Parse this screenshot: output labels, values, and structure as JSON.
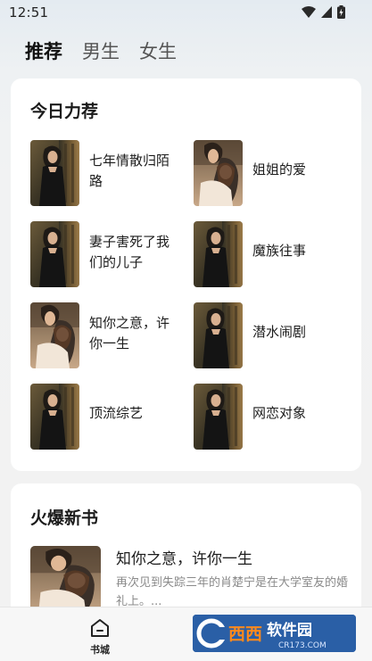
{
  "status_bar": {
    "time": "12:51"
  },
  "top_tabs": [
    {
      "label": "推荐",
      "active": true
    },
    {
      "label": "男生",
      "active": false
    },
    {
      "label": "女生",
      "active": false
    }
  ],
  "today_picks": {
    "title": "今日力荐",
    "books": [
      {
        "title": "七年情散归陌路",
        "cover": "woman-dark-dress"
      },
      {
        "title": "姐姐的爱",
        "cover": "couple-embrace"
      },
      {
        "title": "妻子害死了我们的儿子",
        "cover": "woman-dark-dress"
      },
      {
        "title": "魔族往事",
        "cover": "woman-dark-dress"
      },
      {
        "title": "知你之意，许你一生",
        "cover": "couple-embrace"
      },
      {
        "title": "潜水闹剧",
        "cover": "woman-dark-dress"
      },
      {
        "title": "顶流综艺",
        "cover": "woman-dark-dress"
      },
      {
        "title": "网恋对象",
        "cover": "woman-dark-dress"
      }
    ]
  },
  "hot_new": {
    "title": "火爆新书",
    "featured": {
      "title": "知你之意，许你一生",
      "description": "再次见到失踪三年的肖楚宁是在大学室友的婚礼上。...",
      "cover": "couple-embrace"
    }
  },
  "bottom_nav": {
    "home_label": "书城"
  },
  "watermark": {
    "brand": "西西软件园",
    "url": "CR173.COM"
  },
  "colors": {
    "accent_dark": "#111111",
    "card_bg": "#ffffff",
    "watermark_blue": "#2a66b0"
  }
}
